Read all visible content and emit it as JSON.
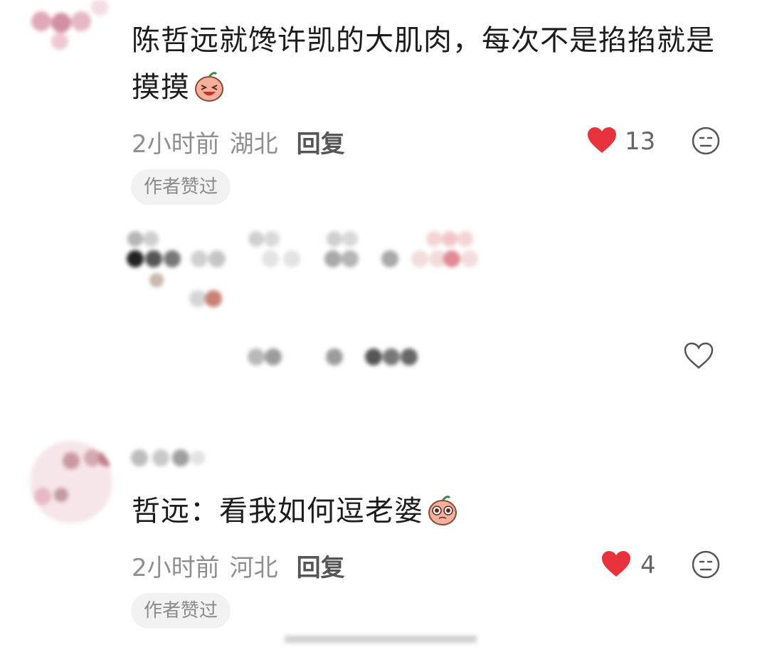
{
  "comments": [
    {
      "text": "陈哲远就馋许凯的大肌肉，每次不是掐掐就是摸摸",
      "emoji": "laugh-emoji",
      "time": "2小时前",
      "location": "湖北",
      "reply_label": "回复",
      "likes": "13",
      "badge": "作者赞过"
    },
    {
      "text": "哲远：看我如何逗老婆",
      "emoji": "pleading-emoji",
      "time": "2小时前",
      "location": "河北",
      "reply_label": "回复",
      "likes": "4",
      "badge": "作者赞过"
    }
  ],
  "colors": {
    "like_red": "#e8333c",
    "meta_gray": "#8f8f8f",
    "badge_bg": "#f2f2f2"
  }
}
